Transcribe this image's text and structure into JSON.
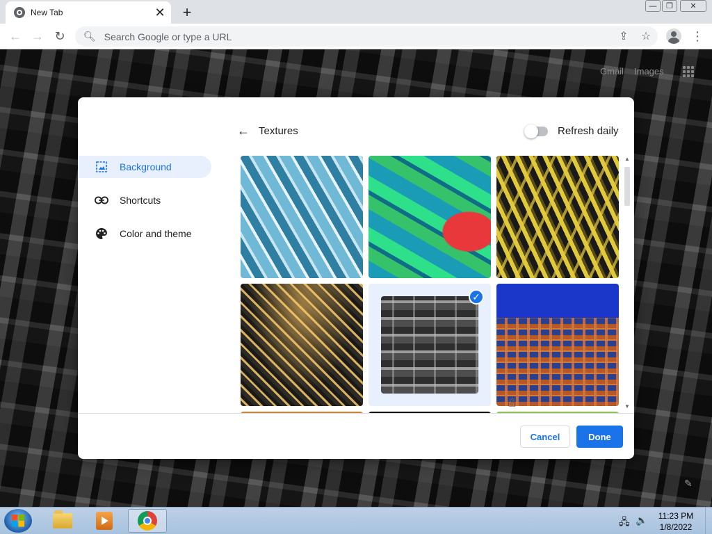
{
  "browser": {
    "tab_title": "New Tab",
    "omnibox_placeholder": "Search Google or type a URL"
  },
  "ntp": {
    "gmail_link": "Gmail",
    "images_link": "Images"
  },
  "dialog": {
    "sidebar": [
      {
        "label": "Background",
        "icon": "image-icon",
        "active": true
      },
      {
        "label": "Shortcuts",
        "icon": "link-icon",
        "active": false
      },
      {
        "label": "Color and theme",
        "icon": "palette-icon",
        "active": false
      }
    ],
    "header_title": "Textures",
    "refresh_daily_label": "Refresh daily",
    "refresh_daily_on": false,
    "selected_tile_index": 4,
    "cancel_label": "Cancel",
    "done_label": "Done"
  },
  "taskbar": {
    "time": "11:23 PM",
    "date": "1/8/2022"
  },
  "colors": {
    "accent": "#1a73e8",
    "sidebar_active_bg": "#e8f0fe",
    "taskbar": "#bcd0e6"
  }
}
